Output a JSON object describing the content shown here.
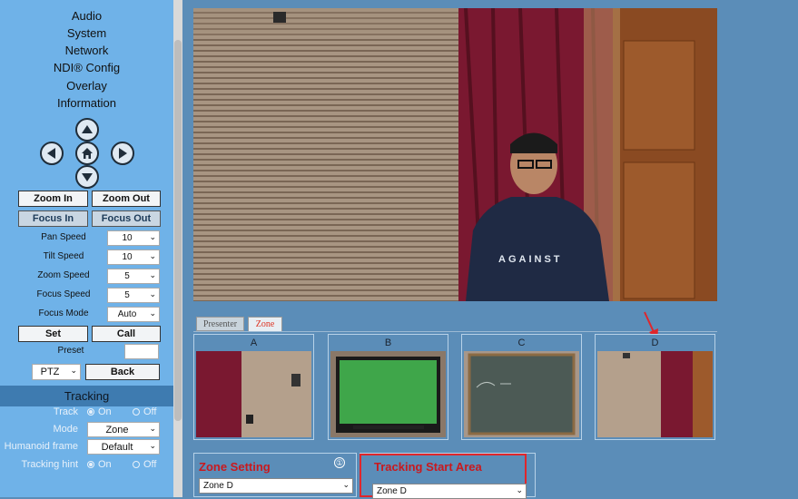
{
  "sidebar": {
    "menu": [
      "Audio",
      "System",
      "Network",
      "NDI® Config",
      "Overlay",
      "Information"
    ],
    "zoom_in": "Zoom In",
    "zoom_out": "Zoom Out",
    "focus_in": "Focus In",
    "focus_out": "Focus Out",
    "speeds": [
      {
        "label": "Pan Speed",
        "value": "10"
      },
      {
        "label": "Tilt Speed",
        "value": "10"
      },
      {
        "label": "Zoom Speed",
        "value": "5"
      },
      {
        "label": "Focus Speed",
        "value": "5"
      },
      {
        "label": "Focus Mode",
        "value": "Auto"
      }
    ],
    "set_label": "Set",
    "call_label": "Call",
    "preset_label": "Preset",
    "preset_value": "",
    "ptz_value": "PTZ",
    "back_label": "Back"
  },
  "tracking": {
    "header": "Tracking",
    "track_label": "Track",
    "on_label": "On",
    "off_label": "Off",
    "mode_label": "Mode",
    "mode_value": "Zone",
    "humanoid_label": "Humanoid frame",
    "humanoid_value": "Default",
    "hint_label": "Tracking hint",
    "hint_on": "On",
    "hint_off": "Off"
  },
  "video": {
    "shirt_text": "AGAINST"
  },
  "tabs": {
    "presenter": "Presenter",
    "zone": "Zone"
  },
  "zones": [
    "A",
    "B",
    "C",
    "D"
  ],
  "zone_setting": {
    "title": "Zone Setting",
    "value": "Zone D",
    "info_icon": "①"
  },
  "tracking_start": {
    "title": "Tracking Start Area",
    "value": "Zone D"
  },
  "colors": {
    "accent_red": "#c9191e",
    "highlight_border": "#e0262b",
    "sidebar_bg": "#6fb2e8",
    "page_bg": "#5b8db8"
  }
}
